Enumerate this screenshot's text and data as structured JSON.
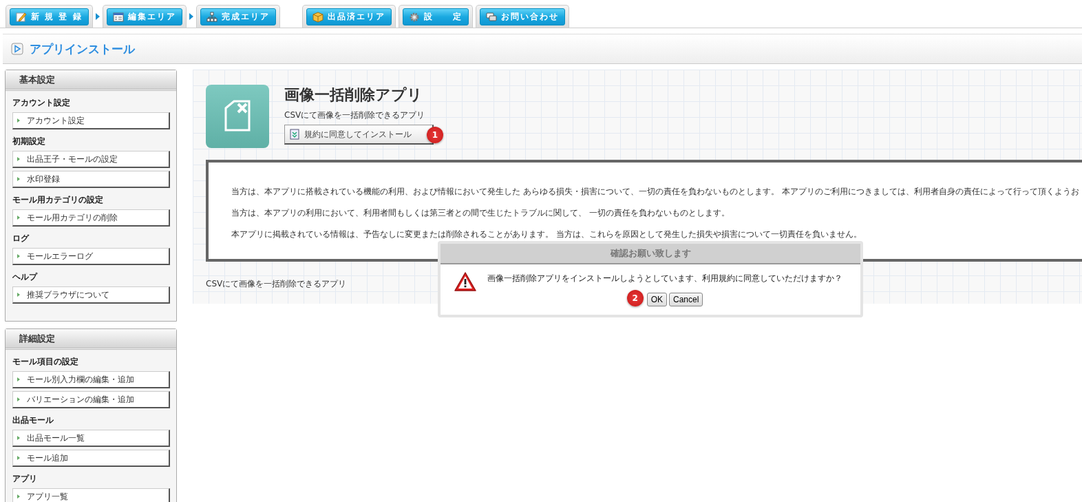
{
  "nav": {
    "steps": [
      {
        "label": "新 規 登 録"
      },
      {
        "label": "編集エリア"
      },
      {
        "label": "完成エリア"
      }
    ],
    "tools": [
      {
        "label": "出品済エリア"
      },
      {
        "label": "設　　定"
      },
      {
        "label": "お問い合わせ"
      }
    ]
  },
  "page_title": "アプリインストール",
  "sidebar": [
    {
      "title": "基本設定",
      "groups": [
        {
          "heading": "アカウント設定",
          "links": [
            "アカウント設定"
          ]
        },
        {
          "heading": "初期設定",
          "links": [
            "出品王子・モールの設定",
            "水印登録"
          ]
        },
        {
          "heading": "モール用カテゴリの設定",
          "links": [
            "モール用カテゴリの削除"
          ]
        },
        {
          "heading": "ログ",
          "links": [
            "モールエラーログ"
          ]
        },
        {
          "heading": "ヘルプ",
          "links": [
            "推奨ブラウザについて"
          ]
        }
      ]
    },
    {
      "title": "詳細設定",
      "groups": [
        {
          "heading": "モール項目の設定",
          "links": [
            "モール別入力欄の編集・追加",
            "バリエーションの編集・追加"
          ]
        },
        {
          "heading": "出品モール",
          "links": [
            "出品モール一覧",
            "モール追加"
          ]
        },
        {
          "heading": "アプリ",
          "links": [
            "アプリ一覧"
          ]
        }
      ]
    }
  ],
  "app": {
    "name": "画像一括削除アプリ",
    "description": "CSVにて画像を一括削除できるアプリ",
    "install_button": "規約に同意してインストール",
    "install_badge": "1",
    "terms": [
      "当方は、本アプリに搭載されている機能の利用、および情報において発生した あらゆる損失・損害について、一切の責任を負わないものとします。 本アプリのご利用につきましては、利用者自身の責任によって行って頂くようお",
      "当方は、本アプリの利用において、利用者間もしくは第三者との間で生じたトラブルに関して、 一切の責任を負わないものとします。",
      "本アプリに掲載されている情報は、予告なしに変更または削除されることがあります。 当方は、これらを原因として発生した損失や損害について一切責任を負いません。"
    ],
    "footer_text": "CSVにて画像を一括削除できるアプリ"
  },
  "dialog": {
    "title": "確認お願い致します",
    "message": "画像一括削除アプリをインストールしようとしています、利用規約に同意していただけますか？",
    "ok_badge": "2",
    "buttons": [
      "OK",
      "Cancel"
    ]
  }
}
